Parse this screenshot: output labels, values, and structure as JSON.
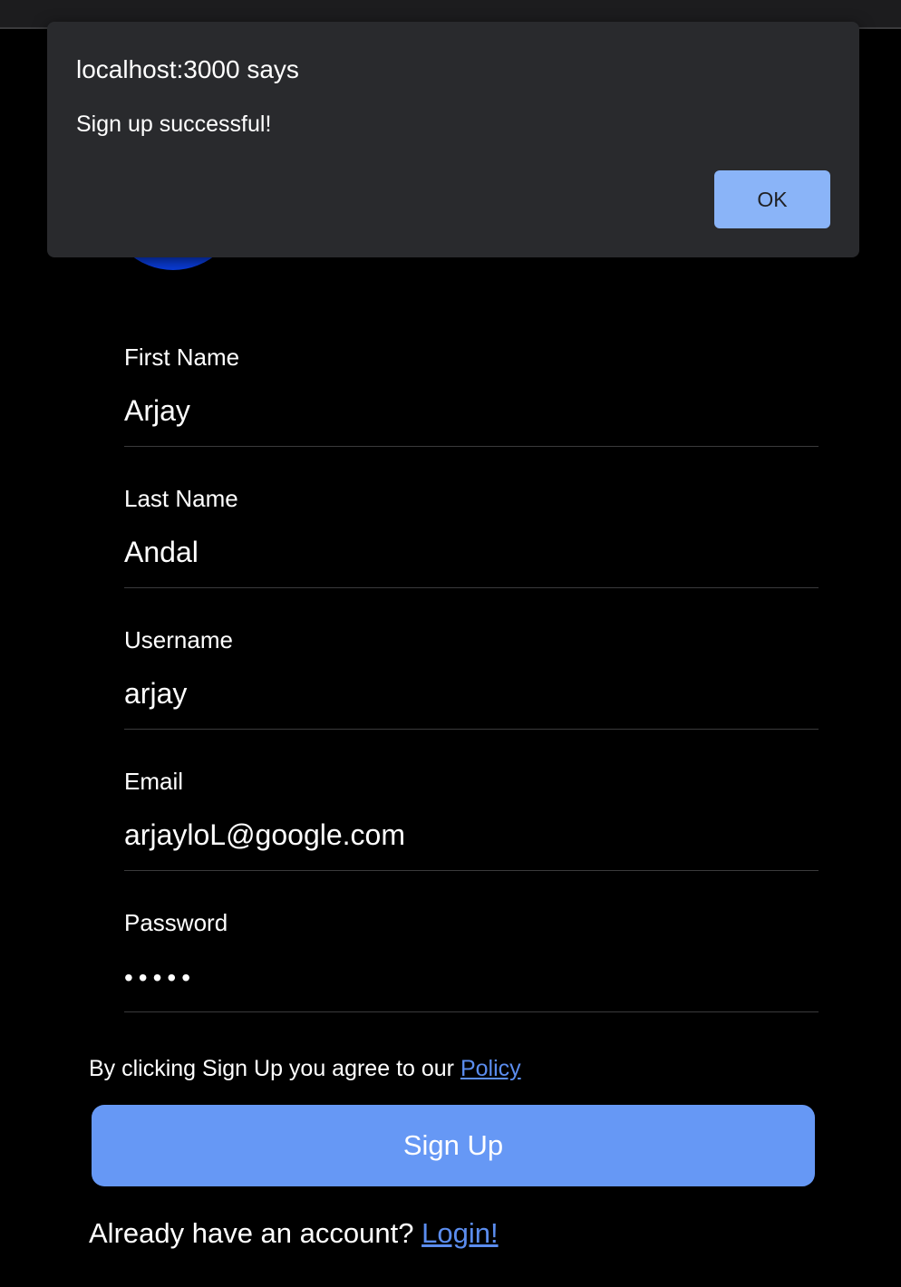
{
  "dialog": {
    "title": "localhost:3000 says",
    "message": "Sign up successful!",
    "ok_label": "OK"
  },
  "form": {
    "fields": [
      {
        "label": "First Name",
        "value": "Arjay"
      },
      {
        "label": "Last Name",
        "value": "Andal"
      },
      {
        "label": "Username",
        "value": "arjay"
      },
      {
        "label": "Email",
        "value": "arjayloL@google.com"
      },
      {
        "label": "Password",
        "value": "•••••"
      }
    ],
    "agree_text": "By clicking Sign Up you agree to our ",
    "policy_link": "Policy",
    "signup_label": "Sign Up",
    "login_prompt": "Already have an account? ",
    "login_link": "Login!"
  },
  "colors": {
    "background": "#000000",
    "accent": "#6698f5",
    "link": "#5b8def",
    "avatar_ring": "#0a3ee0",
    "dialog_bg": "#292a2d",
    "dialog_button": "#8ab4f8"
  }
}
